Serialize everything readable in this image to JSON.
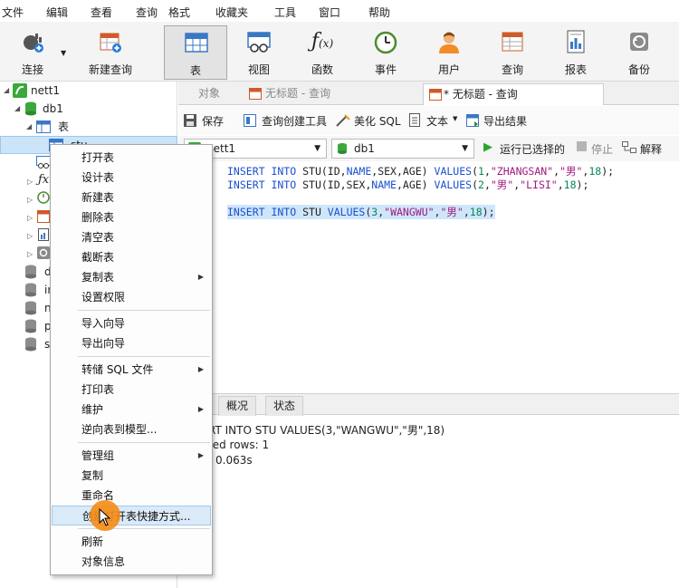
{
  "menubar": [
    "文件",
    "编辑",
    "查看",
    "查询",
    "格式",
    "收藏夹",
    "工具",
    "窗口",
    "帮助"
  ],
  "toolbar": {
    "connect": "连接",
    "new_query": "新建查询",
    "table": "表",
    "view": "视图",
    "function": "函数",
    "event": "事件",
    "user": "用户",
    "query": "查询",
    "report": "报表",
    "backup": "备份"
  },
  "tree": {
    "connection": "nett1",
    "database": "db1",
    "tables_folder": "表",
    "table_stu": "stu",
    "other_dbs": [
      "d",
      "in",
      "n",
      "p",
      "s"
    ]
  },
  "tabs": [
    "对象",
    "无标题 - 查询",
    "* 无标题 - 查询"
  ],
  "query_toolbar": {
    "save": "保存",
    "query_builder": "查询创建工具",
    "beautify": "美化 SQL",
    "text": "文本",
    "export": "导出结果"
  },
  "connbar": {
    "connection": "nett1",
    "database": "db1",
    "run_selected": "运行已选择的",
    "stop": "停止",
    "explain": "解释"
  },
  "result": {
    "tabs": [
      "概况",
      "状态"
    ],
    "line1": "RT INTO STU VALUES(3,\"WANGWU\",\"男\",18)",
    "line2": "ted rows: 1",
    "line3": "0.063s"
  },
  "context_menu": {
    "items": [
      "打开表",
      "设计表",
      "新建表",
      "删除表",
      "清空表",
      "截断表",
      "复制表",
      "设置权限",
      "导入向导",
      "导出向导",
      "转储 SQL 文件",
      "打印表",
      "维护",
      "逆向表到模型...",
      "管理组",
      "复制",
      "重命名",
      "创建打开表快捷方式...",
      "刷新",
      "对象信息"
    ]
  },
  "colors": {
    "accent": "#1a4fcf",
    "selection": "#cce4f7",
    "cursor": "#f58c14"
  }
}
